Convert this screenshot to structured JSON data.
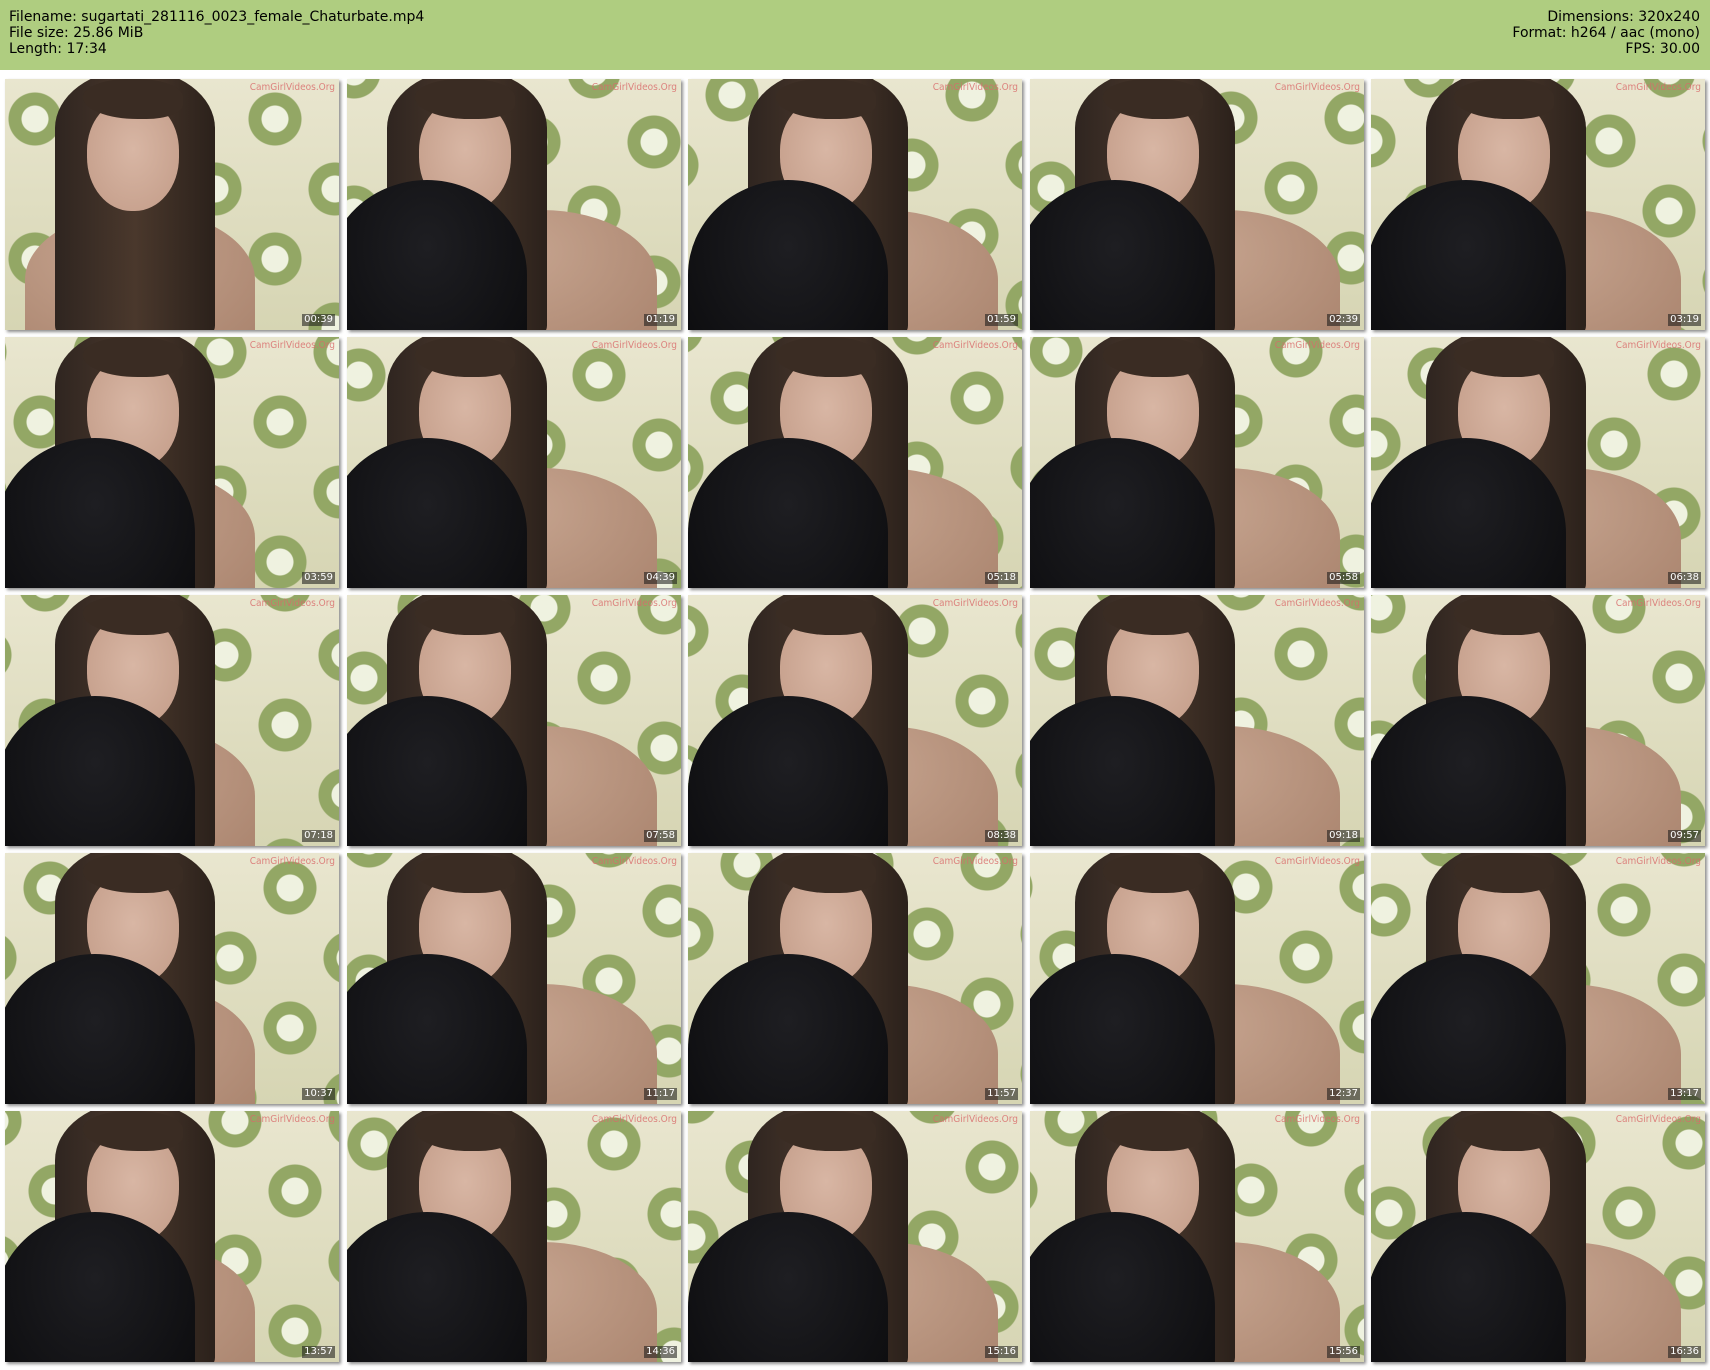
{
  "header": {
    "filename_line": "Filename: sugartati_281116_0023_female_Chaturbate.mp4",
    "filesize_line": "File size: 25.86 MiB",
    "length_line": "Length: 17:34",
    "dimensions_line": "Dimensions: 320x240",
    "format_line": "Format: h264 / aac (mono)",
    "fps_line": "FPS: 30.00"
  },
  "watermark": "CamGirlVideos.Org",
  "thumbnails": [
    {
      "time": "00:39"
    },
    {
      "time": "01:19"
    },
    {
      "time": "01:59"
    },
    {
      "time": "02:39"
    },
    {
      "time": "03:19"
    },
    {
      "time": "03:59"
    },
    {
      "time": "04:39"
    },
    {
      "time": "05:18"
    },
    {
      "time": "05:58"
    },
    {
      "time": "06:38"
    },
    {
      "time": "07:18"
    },
    {
      "time": "07:58"
    },
    {
      "time": "08:38"
    },
    {
      "time": "09:18"
    },
    {
      "time": "09:57"
    },
    {
      "time": "10:37"
    },
    {
      "time": "11:17"
    },
    {
      "time": "11:57"
    },
    {
      "time": "12:37"
    },
    {
      "time": "13:17"
    },
    {
      "time": "13:57"
    },
    {
      "time": "14:36"
    },
    {
      "time": "15:16"
    },
    {
      "time": "15:56"
    },
    {
      "time": "16:36"
    }
  ],
  "colors": {
    "header_background": "#afcd80",
    "wallpaper_green": "#93a765",
    "watermark_red": "#d96a6a"
  }
}
